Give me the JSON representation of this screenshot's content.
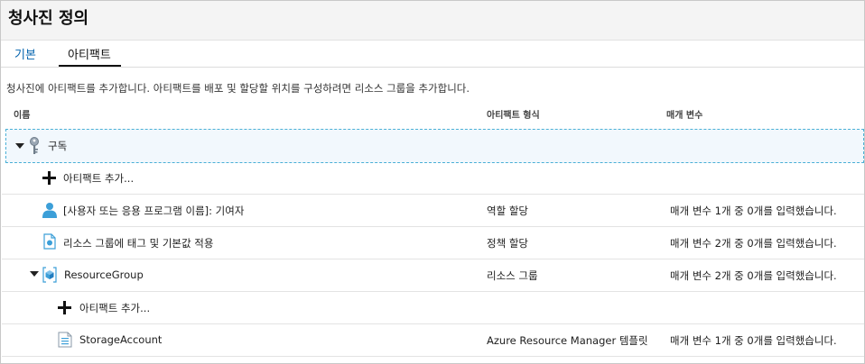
{
  "page": {
    "title": "청사진 정의"
  },
  "tabs": [
    {
      "label": "기본",
      "active": false
    },
    {
      "label": "아티팩트",
      "active": true
    }
  ],
  "description": "청사진에 아티팩트를 추가합니다. 아티팩트를 배포 및 할당할 위치를 구성하려면 리소스 그룹을 추가합니다.",
  "columns": {
    "name": "이름",
    "type": "아티팩트 형식",
    "params": "매개 변수"
  },
  "rows": [
    {
      "name": "구독",
      "type": "",
      "params": "",
      "icon": "key-icon"
    },
    {
      "name": "아티팩트 추가...",
      "type": "",
      "params": "",
      "icon": "plus-icon"
    },
    {
      "name": "[사용자 또는 응용 프로그램 이름]: 기여자",
      "type": "역할 할당",
      "params": "매개 변수 1개 중 0개를 입력했습니다.",
      "icon": "user-icon"
    },
    {
      "name": "리소스 그룹에 태그 및 기본값 적용",
      "type": "정책 할당",
      "params": "매개 변수 2개 중 0개를 입력했습니다.",
      "icon": "policy-icon"
    },
    {
      "name": "ResourceGroup",
      "type": "리소스 그룹",
      "params": "매개 변수 2개 중 0개를 입력했습니다.",
      "icon": "resource-group-icon"
    },
    {
      "name": "아티팩트 추가...",
      "type": "",
      "params": "",
      "icon": "plus-icon"
    },
    {
      "name": "StorageAccount",
      "type": "Azure Resource Manager 템플릿",
      "params": "매개 변수 1개 중 0개를 입력했습니다.",
      "icon": "template-icon"
    }
  ],
  "colors": {
    "accent": "#0062ad",
    "selection_border": "#4ab0d6",
    "icon_blue": "#3c9fd8"
  }
}
